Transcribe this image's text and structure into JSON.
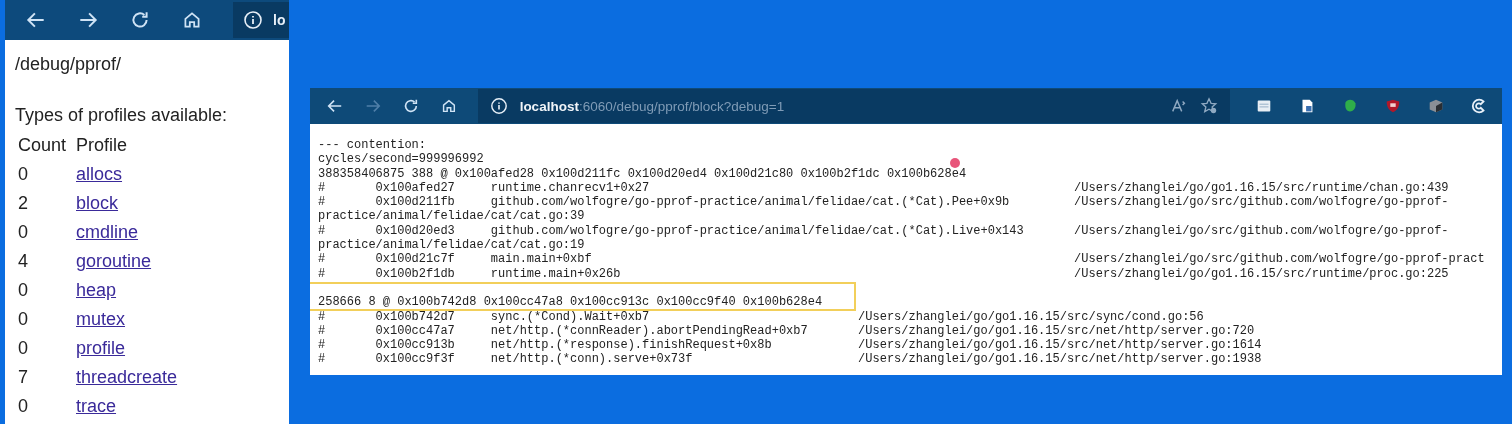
{
  "left_window": {
    "toolbar": {
      "address": "lo",
      "forward_disabled": false
    },
    "path": "/debug/pprof/",
    "intro": "Types of profiles available:",
    "columns": [
      "Count",
      "Profile"
    ],
    "profiles": [
      {
        "count": "0",
        "name": "allocs"
      },
      {
        "count": "2",
        "name": "block"
      },
      {
        "count": "0",
        "name": "cmdline"
      },
      {
        "count": "4",
        "name": "goroutine"
      },
      {
        "count": "0",
        "name": "heap"
      },
      {
        "count": "0",
        "name": "mutex"
      },
      {
        "count": "0",
        "name": "profile"
      },
      {
        "count": "7",
        "name": "threadcreate"
      },
      {
        "count": "0",
        "name": "trace"
      }
    ]
  },
  "right_window": {
    "toolbar": {
      "address_host": "localhost",
      "address_rest": ":6060/debug/pprof/block?debug=1",
      "forward_disabled": true
    },
    "blocks": [
      {
        "highlighted": false,
        "header": [
          "--- contention:",
          "cycles/second=999996992",
          "388358406875 388 @ 0x100afed28 0x100d211fc 0x100d20ed4 0x100d21c80 0x100b2f1dc 0x100b628e4"
        ],
        "rows": [
          {
            "kind": "frame",
            "mark": "#",
            "addr": "0x100afed27",
            "func": "runtime.chanrecv1+0x27",
            "file": "/Users/zhanglei/go/go1.16.15/src/runtime/chan.go:439"
          },
          {
            "kind": "frame",
            "mark": "#",
            "addr": "0x100d211fb",
            "func": "github.com/wolfogre/go-pprof-practice/animal/felidae/cat.(*Cat).Pee+0x9b",
            "file": "/Users/zhanglei/go/src/github.com/wolfogre/go-pprof-"
          },
          {
            "kind": "text",
            "text": "practice/animal/felidae/cat/cat.go:39"
          },
          {
            "kind": "frame",
            "mark": "#",
            "addr": "0x100d20ed3",
            "func": "github.com/wolfogre/go-pprof-practice/animal/felidae/cat.(*Cat).Live+0x143",
            "file": "/Users/zhanglei/go/src/github.com/wolfogre/go-pprof-"
          },
          {
            "kind": "text",
            "text": "practice/animal/felidae/cat/cat.go:19"
          },
          {
            "kind": "frame",
            "mark": "#",
            "addr": "0x100d21c7f",
            "func": "main.main+0xbf",
            "file": "/Users/zhanglei/go/src/github.com/wolfogre/go-pprof-pract"
          },
          {
            "kind": "frame",
            "mark": "#",
            "addr": "0x100b2f1db",
            "func": "runtime.main+0x26b",
            "file": "/Users/zhanglei/go/go1.16.15/src/runtime/proc.go:225"
          }
        ]
      },
      {
        "highlighted": true,
        "header": [
          "258666 8 @ 0x100b742d8 0x100cc47a8 0x100cc913c 0x100cc9f40 0x100b628e4"
        ],
        "rows": [
          {
            "kind": "frame",
            "mark": "#",
            "addr": "0x100b742d7",
            "func": "sync.(*Cond).Wait+0xb7",
            "file": "/Users/zhanglei/go/go1.16.15/src/sync/cond.go:56"
          },
          {
            "kind": "frame",
            "mark": "#",
            "addr": "0x100cc47a7",
            "func": "net/http.(*connReader).abortPendingRead+0xb7",
            "file": "/Users/zhanglei/go/go1.16.15/src/net/http/server.go:720"
          },
          {
            "kind": "frame",
            "mark": "#",
            "addr": "0x100cc913b",
            "func": "net/http.(*response).finishRequest+0x8b",
            "file": "/Users/zhanglei/go/go1.16.15/src/net/http/server.go:1614"
          },
          {
            "kind": "frame",
            "mark": "#",
            "addr": "0x100cc9f3f",
            "func": "net/http.(*conn).serve+0x73f",
            "file": "/Users/zhanglei/go/go1.16.15/src/net/http/server.go:1938"
          }
        ]
      }
    ]
  }
}
